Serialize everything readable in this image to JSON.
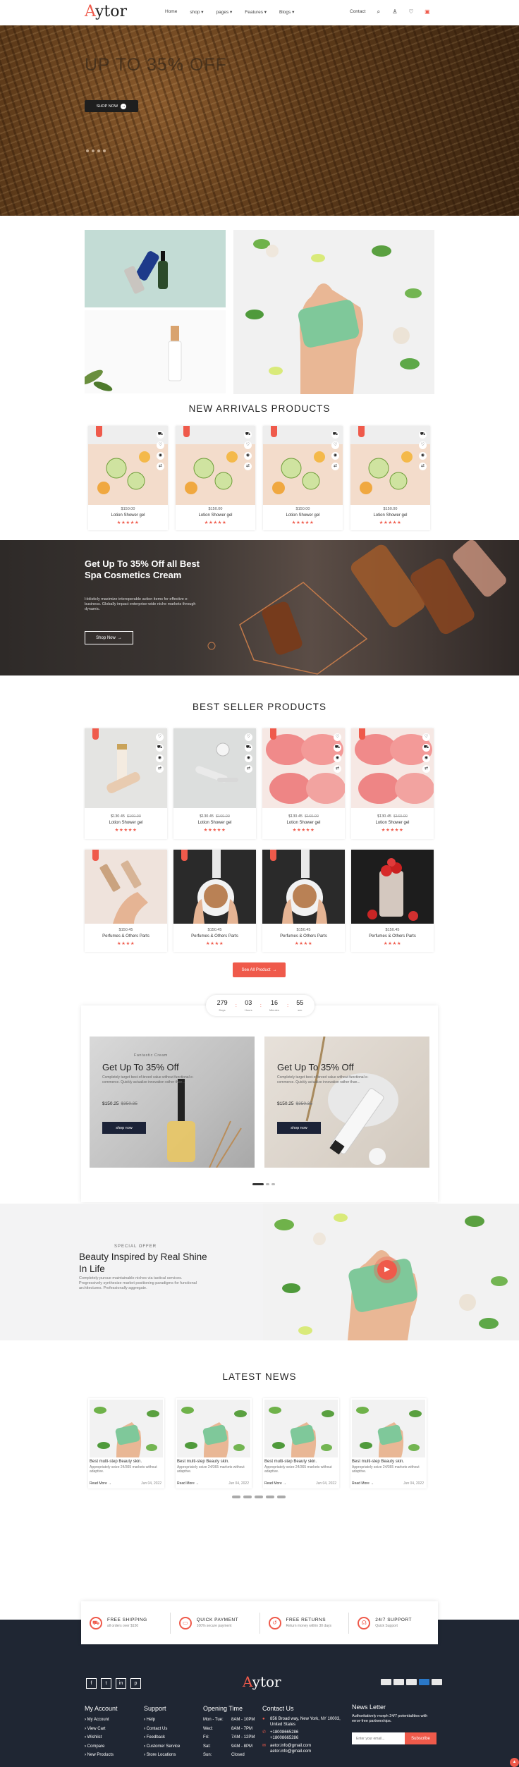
{
  "header": {
    "logo_first": "A",
    "logo_rest": "ytor",
    "nav": [
      "Home",
      "shop ▾",
      "pages ▾",
      "Features ▾",
      "Blogs ▾"
    ],
    "contact": "Contact"
  },
  "hero": {
    "title": "UP TO 35% OFF",
    "button": "SHOP NOW"
  },
  "new_arrivals": {
    "title": "NEW ARRIVALS PRODUCTS",
    "products": [
      {
        "price": "$150.00",
        "name": "Lotion Shower gel",
        "stars": "★★★★★"
      },
      {
        "price": "$150.00",
        "name": "Lotion Shower gel",
        "stars": "★★★★★"
      },
      {
        "price": "$150.00",
        "name": "Lotion Shower gel",
        "stars": "★★★★★"
      },
      {
        "price": "$150.00",
        "name": "Lotion Shower gel",
        "stars": "★★★★★"
      }
    ]
  },
  "cosmetics": {
    "title": "Get Up To 35% Off all Best Spa Cosmetics Cream",
    "text": "Holisticly maximize interoperable action items for effective e-business. Globally impact enterprise-wide niche markets through dynamic.",
    "button": "Shop Now"
  },
  "best_seller": {
    "title": "BEST SELLER PRODUCTS",
    "row1": [
      {
        "price": "$130.45",
        "old": "$160.00",
        "name": "Lotion Shower gel",
        "stars": "★★★★★"
      },
      {
        "price": "$130.45",
        "old": "$160.00",
        "name": "Lotion Shower gel",
        "stars": "★★★★★"
      },
      {
        "price": "$130.45",
        "old": "$160.00",
        "name": "Lotion Shower gel",
        "stars": "★★★★★"
      },
      {
        "price": "$130.45",
        "old": "$160.00",
        "name": "Lotion Shower gel",
        "stars": "★★★★★"
      }
    ],
    "row2": [
      {
        "price": "$150.45",
        "name": "Perfumes & Others Parts",
        "stars": "★★★★"
      },
      {
        "price": "$150.45",
        "name": "Perfumes & Others Parts",
        "stars": "★★★★"
      },
      {
        "price": "$150.45",
        "name": "Perfumes & Others Parts",
        "stars": "★★★★"
      },
      {
        "price": "$150.45",
        "name": "Perfumes & Others Parts",
        "stars": "★★★★"
      }
    ],
    "see_all": "See All Product"
  },
  "countdown": [
    {
      "value": "279",
      "unit": "Days"
    },
    {
      "value": "03",
      "unit": "Hours"
    },
    {
      "value": "16",
      "unit": "Minutes"
    },
    {
      "value": "55",
      "unit": "sec"
    }
  ],
  "deals": [
    {
      "sub": "Fantastic Cream",
      "title": "Get Up To 35% Off",
      "text": "Completely target best-of-breed value without functional e-commerce. Quickly actualize innovation rather than...",
      "price": "$150.25",
      "old": "$350.35",
      "button": "shop now"
    },
    {
      "sub": "",
      "title": "Get Up To 35% Off",
      "text": "Completely target best-of-breed value without functional e-commerce. Quickly actualize innovation rather than...",
      "price": "$150.25",
      "old": "$350.35",
      "button": "shop now"
    }
  ],
  "beauty": {
    "special": "SPECIAL OFFER",
    "title": "Beauty Inspired by Real Shine In Life",
    "text": "Completely pursue maintainable niches via tactical services. Progressively synthesize market positioning paradigms for functional architectures. Professionally aggregate."
  },
  "news": {
    "title": "LATEST NEWS",
    "items": [
      {
        "title": "Best multi-step Beauty skin.",
        "text": "Appropriately seize 24/365 markets without adaptive.",
        "more": "Read More →",
        "date": "Jun 04, 2022"
      },
      {
        "title": "Best multi-step Beauty skin.",
        "text": "Appropriately seize 24/365 markets without adaptive.",
        "more": "Read More →",
        "date": "Jun 04, 2022"
      },
      {
        "title": "Best multi-step Beauty skin.",
        "text": "Appropriately seize 24/365 markets without adaptive.",
        "more": "Read More →",
        "date": "Jun 04, 2022"
      },
      {
        "title": "Best multi-step Beauty skin.",
        "text": "Appropriately seize 24/365 markets without adaptive.",
        "more": "Read More →",
        "date": "Jun 04, 2022"
      }
    ]
  },
  "services": [
    {
      "title": "FREE SHIPPING",
      "sub": "all orders over $150",
      "icon": "truck-icon"
    },
    {
      "title": "QUICK PAYMENT",
      "sub": "100% secure payment",
      "icon": "card-icon"
    },
    {
      "title": "FREE RETURNS",
      "sub": "Return money within 30 days",
      "icon": "return-icon"
    },
    {
      "title": "24/7 SUPPORT",
      "sub": "Quick Support",
      "icon": "headset-icon"
    }
  ],
  "footer": {
    "logo_first": "A",
    "logo_rest": "ytor",
    "social": [
      "f",
      "t",
      "in",
      "p"
    ],
    "account": {
      "title": "My Account",
      "items": [
        "My Account",
        "View Cart",
        "Wishlist",
        "Compare",
        "New Products"
      ]
    },
    "support": {
      "title": "Support",
      "items": [
        "Help",
        "Contact Us",
        "Feedback",
        "Customer Service",
        "Store Locations"
      ]
    },
    "hours": {
      "title": "Opening Time",
      "rows": [
        {
          "day": "Mon - Tue:",
          "time": "8AM - 10PM"
        },
        {
          "day": "Wed:",
          "time": "8AM - 7PM"
        },
        {
          "day": "Fri:",
          "time": "7AM - 12PM"
        },
        {
          "day": "Sat:",
          "time": "9AM - 8PM"
        },
        {
          "day": "Sun:",
          "time": "Closed"
        }
      ]
    },
    "contact": {
      "title": "Contact Us",
      "address1": "856 Broad way, New York, NY 10003,",
      "address2": "United States",
      "phone1": "+18008665286",
      "phone2": "+18008665286",
      "email1": "aetor.info@gmail.com",
      "email2": "aetor.info@gmail.com"
    },
    "newsletter": {
      "title": "News Letter",
      "text": "Authoritatively morph 24/7 potentialities with error-free partnerships.",
      "placeholder": "Enter your email...",
      "button": "Subscribe"
    }
  },
  "colors": {
    "accent": "#ef5a4b",
    "footer_bg": "#1f2633",
    "deal_button": "#1c2338"
  }
}
